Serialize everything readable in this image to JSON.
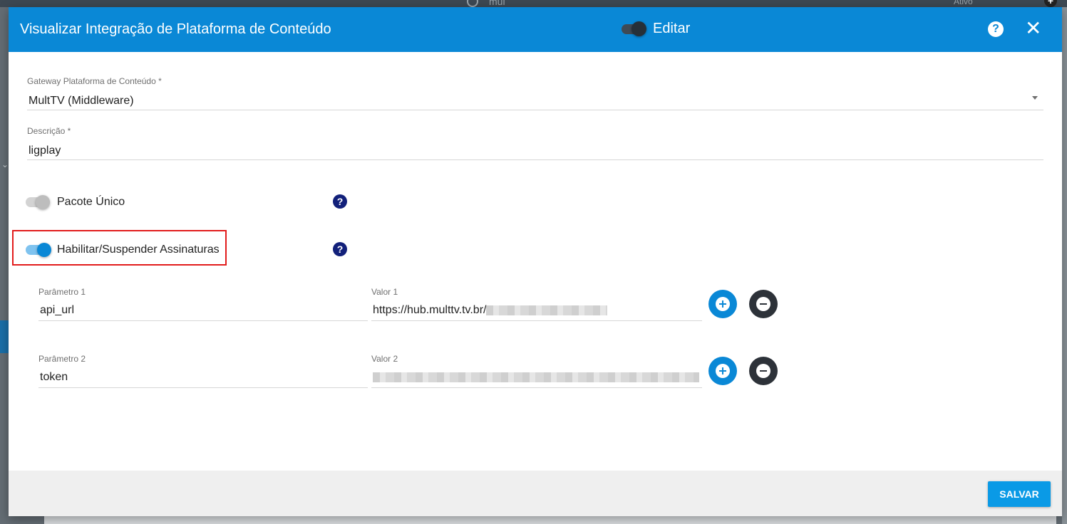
{
  "background": {
    "search_text": "mul",
    "status_text": "Ativo"
  },
  "dialog": {
    "title": "Visualizar Integração de Plataforma de Conteúdo",
    "edit_label": "Editar",
    "edit_on": true
  },
  "form": {
    "gateway": {
      "label": "Gateway Plataforma de Conteúdo *",
      "value": "MultTV (Middleware)"
    },
    "descricao": {
      "label": "Descrição *",
      "value": "ligplay"
    },
    "pacote_unico": {
      "label": "Pacote Único",
      "on": false
    },
    "habilitar": {
      "label": "Habilitar/Suspender Assinaturas",
      "on": true
    },
    "params": [
      {
        "param_label": "Parâmetro 1",
        "param_value": "api_url",
        "valor_label": "Valor 1",
        "valor_value": "https://hub.multtv.tv.br/"
      },
      {
        "param_label": "Parâmetro 2",
        "param_value": "token",
        "valor_label": "Valor 2",
        "valor_value": ""
      }
    ]
  },
  "footer": {
    "save_label": "SALVAR"
  },
  "colors": {
    "header": "#0a88d6",
    "accent": "#0a88d6",
    "highlight": "#e21c1c",
    "help": "#12207a"
  }
}
